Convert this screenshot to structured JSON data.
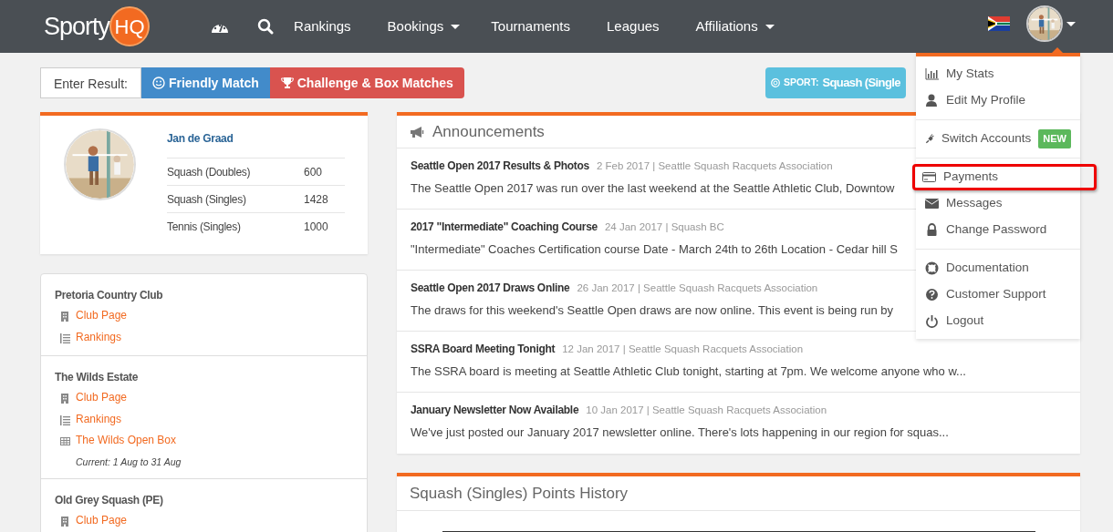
{
  "navbar": {
    "logo": {
      "text": "Sporty",
      "badge": "HQ"
    },
    "items": [
      {
        "label": "Rankings",
        "dropdown": false
      },
      {
        "label": "Bookings",
        "dropdown": true
      },
      {
        "label": "Tournaments",
        "dropdown": false
      },
      {
        "label": "Leagues",
        "dropdown": false
      },
      {
        "label": "Affiliations",
        "dropdown": true
      }
    ]
  },
  "toolbar": {
    "label": "Enter Result:",
    "buttons": [
      {
        "kind": "friendly",
        "label": "Friendly Match"
      },
      {
        "kind": "challenge",
        "label": "Challenge & Box Matches"
      }
    ],
    "sport": {
      "label": "SPORT:",
      "value": "Squash (Single"
    }
  },
  "profile": {
    "name": "Jan de Graad",
    "ratings": [
      {
        "sport": "Squash (Doubles)",
        "points": "600"
      },
      {
        "sport": "Squash (Singles)",
        "points": "1428"
      },
      {
        "sport": "Tennis (Singles)",
        "points": "1000"
      }
    ]
  },
  "clubs": [
    {
      "name": "Pretoria Country Club",
      "links": [
        {
          "kind": "club",
          "label": "Club Page"
        },
        {
          "kind": "rankings",
          "label": "Rankings"
        }
      ]
    },
    {
      "name": "The Wilds Estate",
      "links": [
        {
          "kind": "club",
          "label": "Club Page"
        },
        {
          "kind": "rankings",
          "label": "Rankings"
        },
        {
          "kind": "box",
          "label": "The Wilds Open Box",
          "note": "Current: 1 Aug to 31 Aug"
        }
      ]
    },
    {
      "name": "Old Grey Squash (PE)",
      "links": [
        {
          "kind": "club",
          "label": "Club Page"
        }
      ]
    }
  ],
  "announcements": {
    "title": "Announcements",
    "items": [
      {
        "title": "Seattle Open 2017 Results & Photos",
        "meta": "2 Feb 2017 | Seattle Squash Racquets Association",
        "text": "The Seattle Open 2017 was run over the last weekend at the Seattle Athletic Club, Downtow"
      },
      {
        "title": "2017 \"Intermediate\" Coaching Course",
        "meta": "24 Jan 2017 | Squash BC",
        "text": "\"Intermediate\" Coaches Certification course Date - March 24th to 26th Location - Cedar hill S"
      },
      {
        "title": "Seattle Open 2017 Draws Online",
        "meta": "26 Jan 2017 | Seattle Squash Racquets Association",
        "text": "The draws for this weekend's Seattle Open draws are now online. This event is being run by"
      },
      {
        "title": "SSRA Board Meeting Tonight",
        "meta": "12 Jan 2017 | Seattle Squash Racquets Association",
        "text": "The SSRA board is meeting at Seattle Athletic Club tonight, starting at 7pm. We welcome anyone who w..."
      },
      {
        "title": "January Newsletter Now Available",
        "meta": "10 Jan 2017 | Seattle Squash Racquets Association",
        "text": "We've just posted our January 2017 newsletter online. There's lots happening in our region for squas..."
      }
    ]
  },
  "history": {
    "title": "Squash (Singles) Points History"
  },
  "user_menu": {
    "groups": [
      [
        {
          "kind": "stats",
          "label": "My Stats",
          "highlighted": false
        },
        {
          "kind": "profile",
          "label": "Edit My Profile",
          "highlighted": false
        }
      ],
      [
        {
          "kind": "switch",
          "label": "Switch Accounts",
          "badge": "NEW",
          "highlighted": false
        }
      ],
      [
        {
          "kind": "payments",
          "label": "Payments",
          "highlighted": true
        },
        {
          "kind": "messages",
          "label": "Messages",
          "highlighted": false
        },
        {
          "kind": "password",
          "label": "Change Password",
          "highlighted": false
        }
      ],
      [
        {
          "kind": "docs",
          "label": "Documentation",
          "highlighted": false
        },
        {
          "kind": "support",
          "label": "Customer Support",
          "highlighted": false
        },
        {
          "kind": "logout",
          "label": "Logout",
          "highlighted": false
        }
      ]
    ]
  }
}
